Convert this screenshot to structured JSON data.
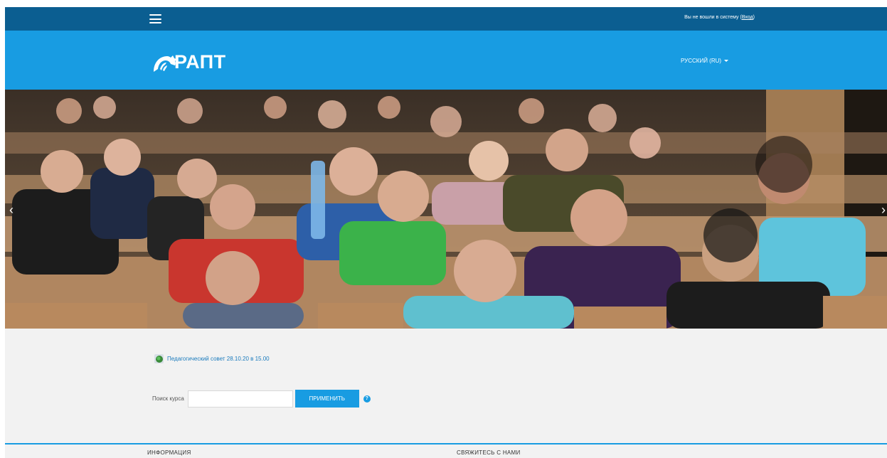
{
  "topbar": {
    "login_status": "Вы не вошли в систему",
    "login_link": "Вход"
  },
  "header": {
    "logo_text": "РАПТ",
    "language": "РУССКИЙ (RU)"
  },
  "slider": {
    "prev_icon": "chevron-left-icon",
    "next_icon": "chevron-right-icon"
  },
  "news": {
    "link_text": "Педагогический совет 28.10.20 в 15.00"
  },
  "search": {
    "label": "Поиск курса",
    "value": "",
    "placeholder": "",
    "button": "ПРИМЕНИТЬ",
    "help": "?"
  },
  "footer": {
    "info": "ИНФОРМАЦИЯ",
    "contact": "СВЯЖИТЕСЬ С НАМИ"
  },
  "colors": {
    "topbar": "#0b5e91",
    "header": "#189ce2",
    "page_bg": "#f2f2f2",
    "link": "#1b7bbd"
  }
}
